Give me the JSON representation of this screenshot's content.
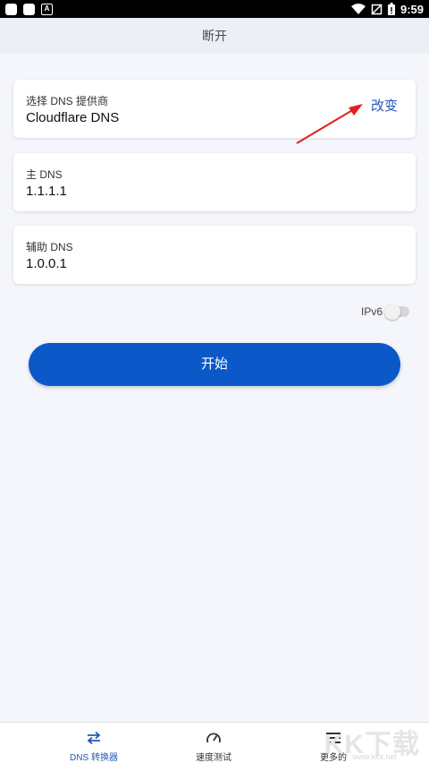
{
  "status_bar": {
    "time": "9:59",
    "notif_letter": "A"
  },
  "header": {
    "title": "断开"
  },
  "provider_card": {
    "label": "选择 DNS 提供商",
    "value": "Cloudflare DNS",
    "change_label": "改变"
  },
  "primary_dns": {
    "label": "主 DNS",
    "value": "1.1.1.1"
  },
  "secondary_dns": {
    "label": "辅助 DNS",
    "value": "1.0.0.1"
  },
  "ipv6": {
    "label": "IPv6",
    "enabled": false
  },
  "start_button": {
    "label": "开始"
  },
  "bottom_nav": {
    "items": [
      {
        "label": "DNS 转换器",
        "icon": "swap-arrows-icon",
        "active": true
      },
      {
        "label": "速度测试",
        "icon": "speedometer-icon",
        "active": false
      },
      {
        "label": "更多的",
        "icon": "menu-icon",
        "active": false
      }
    ]
  },
  "watermark": {
    "text": "KK下载",
    "url": "www.kkx.net"
  },
  "colors": {
    "accent": "#0b58c8",
    "link": "#2458b8",
    "annotation_arrow": "#e02020"
  }
}
